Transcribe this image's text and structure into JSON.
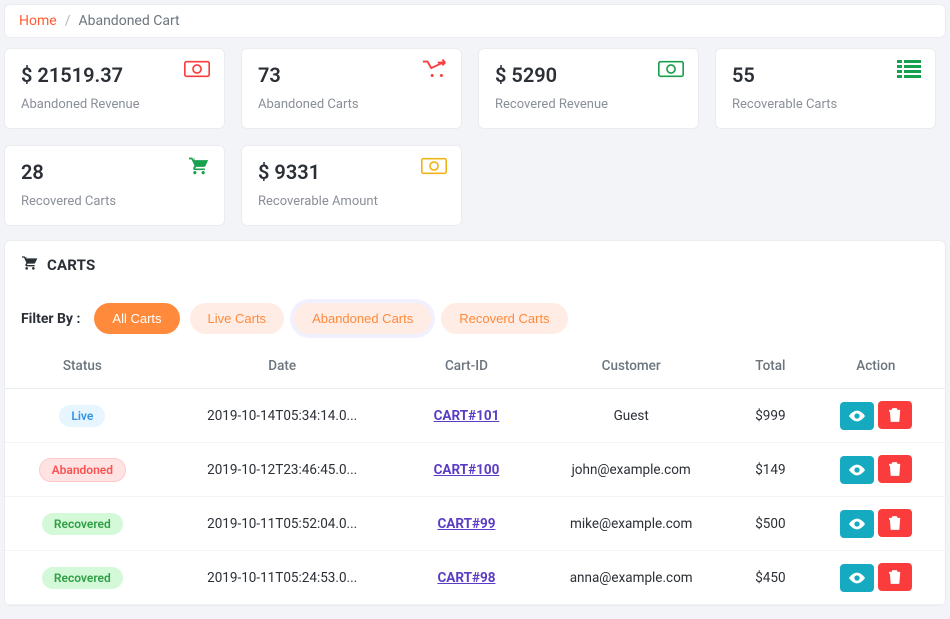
{
  "breadcrumb": {
    "home": "Home",
    "sep": "/",
    "current": "Abandoned Cart"
  },
  "stats": [
    {
      "value": "$ 21519.37",
      "label": "Abandoned Revenue",
      "icon": "money",
      "color": "#fa3c3c"
    },
    {
      "value": "73",
      "label": "Abandoned Carts",
      "icon": "cart-arrow",
      "color": "#fa3c3c"
    },
    {
      "value": "$ 5290",
      "label": "Recovered Revenue",
      "icon": "money",
      "color": "#18a04e"
    },
    {
      "value": "55",
      "label": "Recoverable Carts",
      "icon": "list",
      "color": "#18a04e"
    },
    {
      "value": "28",
      "label": "Recovered Carts",
      "icon": "cart",
      "color": "#18a04e"
    },
    {
      "value": "$ 9331",
      "label": "Recoverable Amount",
      "icon": "money",
      "color": "#f0b418"
    }
  ],
  "panel": {
    "title": "CARTS"
  },
  "filter": {
    "label": "Filter By :",
    "pills": [
      "All Carts",
      "Live Carts",
      "Abandoned Carts",
      "Recoverd Carts"
    ],
    "active": 0
  },
  "table": {
    "headers": [
      "Status",
      "Date",
      "Cart-ID",
      "Customer",
      "Total",
      "Action"
    ],
    "rows": [
      {
        "status": "Live",
        "status_class": "status-live",
        "date": "2019-10-14T05:34:14.0...",
        "cart_id": "CART#101",
        "customer": "Guest",
        "total": "$999"
      },
      {
        "status": "Abandoned",
        "status_class": "status-abandoned",
        "date": "2019-10-12T23:46:45.0...",
        "cart_id": "CART#100",
        "customer": "john@example.com",
        "total": "$149"
      },
      {
        "status": "Recovered",
        "status_class": "status-recovered",
        "date": "2019-10-11T05:52:04.0...",
        "cart_id": "CART#99",
        "customer": "mike@example.com",
        "total": "$500"
      },
      {
        "status": "Recovered",
        "status_class": "status-recovered",
        "date": "2019-10-11T05:24:53.0...",
        "cart_id": "CART#98",
        "customer": "anna@example.com",
        "total": "$450"
      }
    ]
  }
}
